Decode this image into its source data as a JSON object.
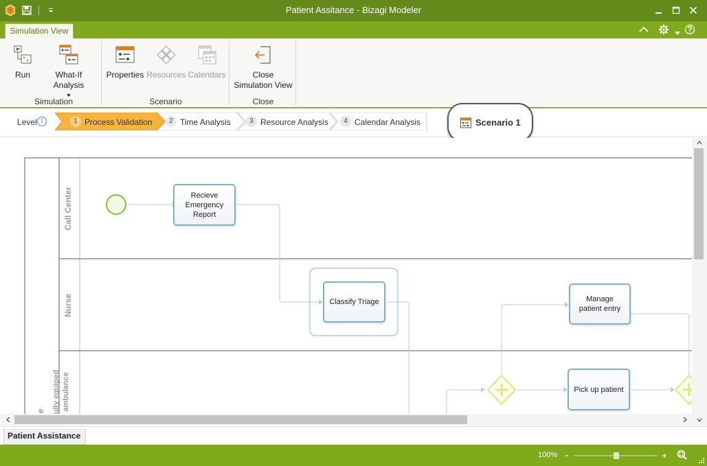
{
  "window": {
    "title": "Patient Assitance - Bizagi Modeler"
  },
  "ribbon": {
    "active_tab": "Simulation View",
    "groups": {
      "simulation": {
        "label": "Simulation",
        "run": "Run",
        "what_if": "What-If Analysis"
      },
      "scenario": {
        "label": "Scenario",
        "properties": "Properties",
        "resources": "Resources",
        "calendars": "Calendars"
      },
      "close": {
        "label": "Close",
        "close_line1": "Close",
        "close_line2": "Simulation View"
      }
    }
  },
  "levels": {
    "label": "Level",
    "info": "i",
    "steps": [
      {
        "num": "1",
        "label": "Process Validation",
        "active": true
      },
      {
        "num": "2",
        "label": "Time Analysis",
        "active": false
      },
      {
        "num": "3",
        "label": "Resource Analysis",
        "active": false
      },
      {
        "num": "4",
        "label": "Calendar Analysis",
        "active": false
      }
    ]
  },
  "scenario": {
    "name": "Scenario 1"
  },
  "diagram": {
    "pool_label": "e",
    "lanes": [
      "Call Center",
      "Nurse",
      "ully equiped ambulance"
    ],
    "tasks": {
      "recieve": "Recieve Emergency Report",
      "recieve_l1": "Recieve",
      "recieve_l2": "Emergency",
      "recieve_l3": "Report",
      "classify": "Classify Triage",
      "manage_l1": "Manage",
      "manage_l2": "patient entry",
      "pickup": "Pick up patient"
    }
  },
  "document_tabs": [
    "Patient Assistance"
  ],
  "status": {
    "zoom": "100%"
  },
  "colors": {
    "titlebar": "#638a1a",
    "accent": "#80a91c",
    "active_step": "#f8b33e",
    "task_border": "#7fb0c8",
    "gateway": "#d9e68a"
  }
}
